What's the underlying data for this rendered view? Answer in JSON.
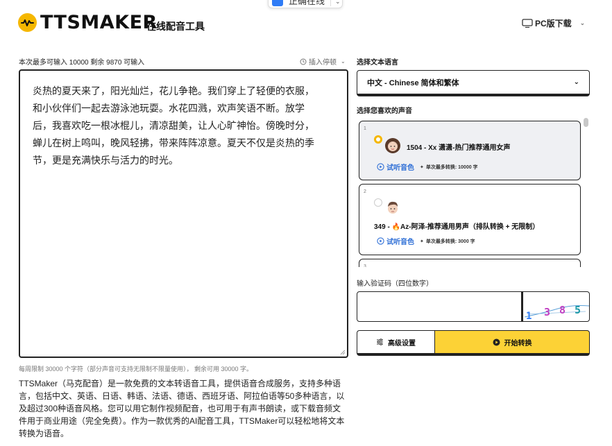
{
  "top_pill": {
    "label": "正确在线",
    "chevron": "chevron-down-icon"
  },
  "header": {
    "logo_text": "TTSMAKER",
    "logo_subtitle": "在线配音工具",
    "pc_download_label": "PC版下载",
    "brand_color": "#f5b700"
  },
  "editor": {
    "limit_text": "本次最多可输入 10000 剩余 9870 可输入",
    "insert_pause_label": "插入停顿",
    "content": "炎热的夏天来了，阳光灿烂，花儿争艳。我们穿上了轻便的衣服，\n和小伙伴们一起去游泳池玩耍。水花四溅，欢声笑语不断。放学\n后，我喜欢吃一根冰棍儿，清凉甜美，让人心旷神怡。傍晚时分，\n蝉儿在树上鸣叫，晚风轻拂，带来阵阵凉意。夏天不仅是炎热的季\n节，更是充满快乐与活力的时光。",
    "footnote": "每周限制 30000 个字符（部分声音可支持无限制不限量使用）， 剩余可用 30000 字。",
    "description": "TTSMaker（马克配音）是一款免费的文本转语音工具，提供语音合成服务，支持多种语言，包括中文、英语、日语、韩语、法语、德语、西班牙语、阿拉伯语等50多种语言，以及超过300种语音风格。您可以用它制作视频配音，也可用于有声书朗读，或下载音频文件用于商业用途（完全免费）。作为一款优秀的AI配音工具，TTSMaker可以轻松地将文本转换为语音。"
  },
  "language": {
    "label": "选择文本语言",
    "selected": "中文 - Chinese 简体和繁体"
  },
  "voices": {
    "label": "选择您喜欢的声音",
    "items": [
      {
        "index": "1",
        "name": "1504 - Xx 潇潇-热门推荐通用女声",
        "listen_label": "试听音色",
        "max_label": "单次最多转换: 10000 字",
        "selected": true
      },
      {
        "index": "2",
        "name": "349 - 🔥Az-阿泽-推荐通用男声（排队转换 + 无限制）",
        "listen_label": "试听音色",
        "max_label": "单次最多转换: 3000 字",
        "selected": false
      },
      {
        "index": "3",
        "name": "",
        "listen_label": "",
        "max_label": "",
        "selected": false
      }
    ]
  },
  "captcha": {
    "label": "输入验证码（四位数字）",
    "input_value": "",
    "digits": "1385"
  },
  "actions": {
    "advanced_label": "高级设置",
    "start_label": "开始转换",
    "start_color": "#fcd236"
  }
}
